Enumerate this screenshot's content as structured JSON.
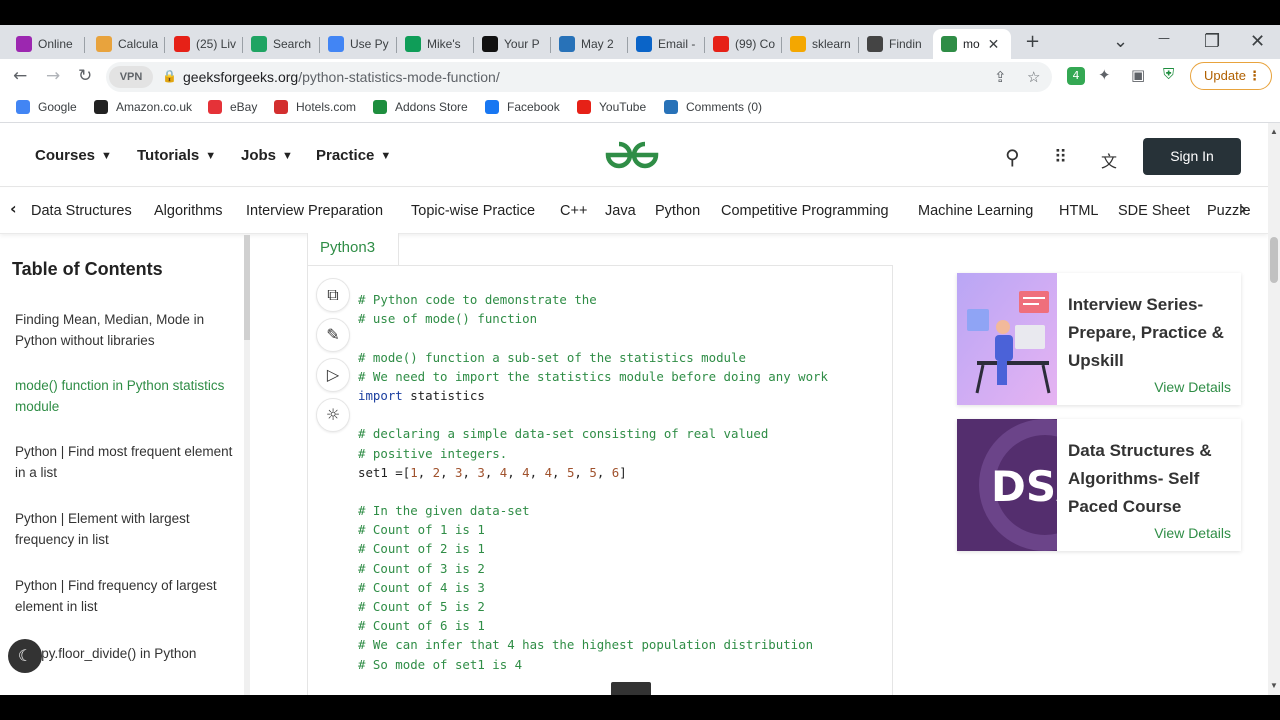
{
  "browser": {
    "tabs": [
      {
        "label": "Online",
        "icon": "online-icon",
        "color": "#9c27b0"
      },
      {
        "label": "Calcula",
        "icon": "calculator-icon",
        "color": "#e8a33d"
      },
      {
        "label": "(25) Liv",
        "icon": "youtube-icon",
        "color": "#e62117"
      },
      {
        "label": "Search",
        "icon": "google-drive-icon",
        "color": "#1fa463"
      },
      {
        "label": "Use Py",
        "icon": "docs-icon",
        "color": "#4285f4"
      },
      {
        "label": "Mike's",
        "icon": "sheets-icon",
        "color": "#0f9d58"
      },
      {
        "label": "Your P",
        "icon": "medium-icon",
        "color": "#111111"
      },
      {
        "label": "May 2",
        "icon": "k-icon",
        "color": "#2872b8"
      },
      {
        "label": "Email -",
        "icon": "outlook-icon",
        "color": "#0a64c8"
      },
      {
        "label": "(99) Co",
        "icon": "youtube-icon",
        "color": "#e62117"
      },
      {
        "label": "sklearn",
        "icon": "chart-icon",
        "color": "#f4a700"
      },
      {
        "label": "Findin",
        "icon": "diamond-icon",
        "color": "#444444"
      },
      {
        "label": "mo",
        "icon": "gfg-icon",
        "color": "#2f8d46"
      }
    ],
    "url_domain": "geeksforgeeks.org",
    "url_path": "/python-statistics-mode-function/",
    "vpn_label": "VPN",
    "update_label": "Update",
    "ext_badge": "4",
    "bookmarks": [
      {
        "label": "Google",
        "icon": "google-icon",
        "color": "#4285f4"
      },
      {
        "label": "Amazon.co.uk",
        "icon": "amazon-icon",
        "color": "#222222"
      },
      {
        "label": "eBay",
        "icon": "ebay-icon",
        "color": "#e53238"
      },
      {
        "label": "Hotels.com",
        "icon": "hotels-icon",
        "color": "#d32f2f"
      },
      {
        "label": "Addons Store",
        "icon": "addons-icon",
        "color": "#1e8e3e"
      },
      {
        "label": "Facebook",
        "icon": "facebook-icon",
        "color": "#1877f2"
      },
      {
        "label": "YouTube",
        "icon": "youtube-icon",
        "color": "#e62117"
      },
      {
        "label": "Comments (0)",
        "icon": "k-icon",
        "color": "#2872b8"
      }
    ]
  },
  "site": {
    "menus": [
      "Courses",
      "Tutorials",
      "Jobs",
      "Practice"
    ],
    "sign_in": "Sign In",
    "brand_color": "#2f8d46",
    "categories": [
      "Data Structures",
      "Algorithms",
      "Interview Preparation",
      "Topic-wise Practice",
      "C++",
      "Java",
      "Python",
      "Competitive Programming",
      "Machine Learning",
      "HTML",
      "SDE Sheet",
      "Puzzle"
    ]
  },
  "toc": {
    "title": "Table of Contents",
    "items": [
      {
        "text": "Finding Mean, Median, Mode in Python without libraries",
        "active": false
      },
      {
        "text": "mode() function in Python statistics module",
        "active": true
      },
      {
        "text": "Python | Find most frequent element in a list",
        "active": false
      },
      {
        "text": "Python | Element with largest frequency in list",
        "active": false
      },
      {
        "text": "Python | Find frequency of largest element in list",
        "active": false
      },
      {
        "text": "numpy.floor_divide() in Python",
        "active": false
      }
    ]
  },
  "code": {
    "language_tab": "Python3",
    "lines": [
      [
        {
          "t": "# Python code to demonstrate the",
          "c": "cm"
        }
      ],
      [
        {
          "t": "# use of mode() function",
          "c": "cm"
        }
      ],
      [
        {
          "t": "",
          "c": ""
        }
      ],
      [
        {
          "t": "# mode() function a sub-set of the statistics module",
          "c": "cm"
        }
      ],
      [
        {
          "t": "# We need to import the statistics module before doing any work",
          "c": "cm"
        }
      ],
      [
        {
          "t": "import",
          "c": "kw"
        },
        {
          "t": " statistics",
          "c": ""
        }
      ],
      [
        {
          "t": "",
          "c": ""
        }
      ],
      [
        {
          "t": "# declaring a simple data-set consisting of real valued",
          "c": "cm"
        }
      ],
      [
        {
          "t": "# positive integers.",
          "c": "cm"
        }
      ],
      [
        {
          "t": "set1 =[",
          "c": ""
        },
        {
          "t": "1",
          "c": "num"
        },
        {
          "t": ", ",
          "c": ""
        },
        {
          "t": "2",
          "c": "num"
        },
        {
          "t": ", ",
          "c": ""
        },
        {
          "t": "3",
          "c": "num"
        },
        {
          "t": ", ",
          "c": ""
        },
        {
          "t": "3",
          "c": "num"
        },
        {
          "t": ", ",
          "c": ""
        },
        {
          "t": "4",
          "c": "num"
        },
        {
          "t": ", ",
          "c": ""
        },
        {
          "t": "4",
          "c": "num"
        },
        {
          "t": ", ",
          "c": ""
        },
        {
          "t": "4",
          "c": "num"
        },
        {
          "t": ", ",
          "c": ""
        },
        {
          "t": "5",
          "c": "num"
        },
        {
          "t": ", ",
          "c": ""
        },
        {
          "t": "5",
          "c": "num"
        },
        {
          "t": ", ",
          "c": ""
        },
        {
          "t": "6",
          "c": "num"
        },
        {
          "t": "]",
          "c": ""
        }
      ],
      [
        {
          "t": "",
          "c": ""
        }
      ],
      [
        {
          "t": "# In the given data-set",
          "c": "cm"
        }
      ],
      [
        {
          "t": "# Count of 1 is 1",
          "c": "cm"
        }
      ],
      [
        {
          "t": "# Count of 2 is 1",
          "c": "cm"
        }
      ],
      [
        {
          "t": "# Count of 3 is 2",
          "c": "cm"
        }
      ],
      [
        {
          "t": "# Count of 4 is 3",
          "c": "cm"
        }
      ],
      [
        {
          "t": "# Count of 5 is 2",
          "c": "cm"
        }
      ],
      [
        {
          "t": "# Count of 6 is 1",
          "c": "cm"
        }
      ],
      [
        {
          "t": "# We can infer that 4 has the highest population distribution",
          "c": "cm"
        }
      ],
      [
        {
          "t": "# So mode of set1 is 4",
          "c": "cm"
        }
      ]
    ]
  },
  "sidebar_cards": [
    {
      "title": "Interview Series- Prepare, Practice & Upskill",
      "link": "View Details"
    },
    {
      "title": "Data Structures & Algorithms- Self Paced Course",
      "link": "View Details",
      "image_text": "DSA"
    }
  ]
}
